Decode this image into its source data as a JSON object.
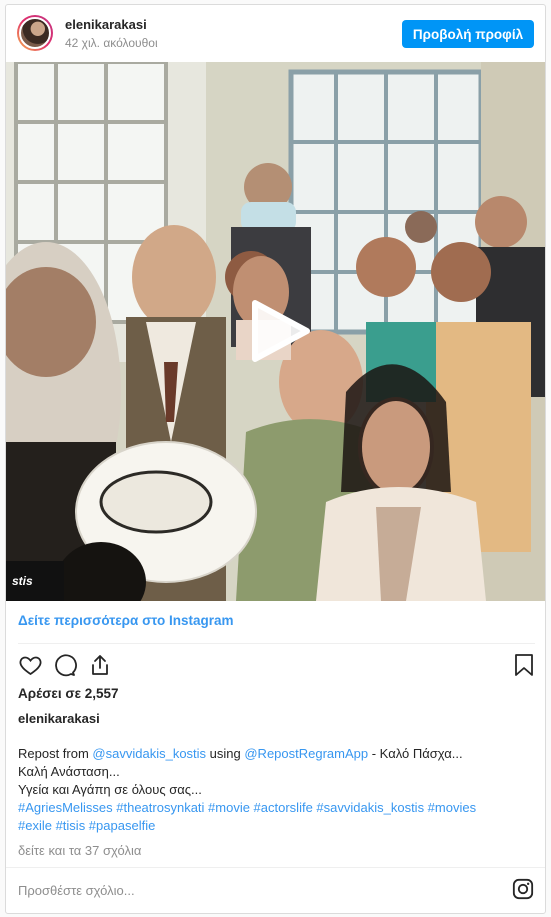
{
  "header": {
    "username": "elenikarakasi",
    "followers": "42 χιλ. ακόλουθοι",
    "profile_button": "Προβολή προφίλ"
  },
  "media": {
    "watermark_text": "stis",
    "play_icon": "play-icon"
  },
  "more_link": "Δείτε περισσότερα στο Instagram",
  "actions": {
    "like_icon": "heart-icon",
    "comment_icon": "comment-icon",
    "share_icon": "share-icon",
    "save_icon": "bookmark-icon"
  },
  "likes": "Αρέσει σε 2,557",
  "caption": {
    "username": "elenikarakasi",
    "line1_a": "Repost from ",
    "mention1": "@savvidakis_kostis",
    "line1_b": " using ",
    "mention2": "@RepostRegramApp",
    "line1_c": " - Καλό Πάσχα...",
    "line2": "Καλή Ανάσταση...",
    "line3": "Υγεία και Αγάπη σε όλους σας...",
    "hashtags_line1": "#AgriesMelisses #theatrosynkati #movie #actorslife #savvidakis_kostis #movies",
    "hashtags_line2": "#exile #tisis #papaselfie"
  },
  "comments_link": "δείτε και τα 37 σχόλια",
  "comment_input": {
    "placeholder": "Προσθέστε σχόλιο..."
  },
  "colors": {
    "accent": "#0095f6",
    "link": "#3897f0",
    "muted": "#8e8e8e",
    "text": "#262626"
  }
}
